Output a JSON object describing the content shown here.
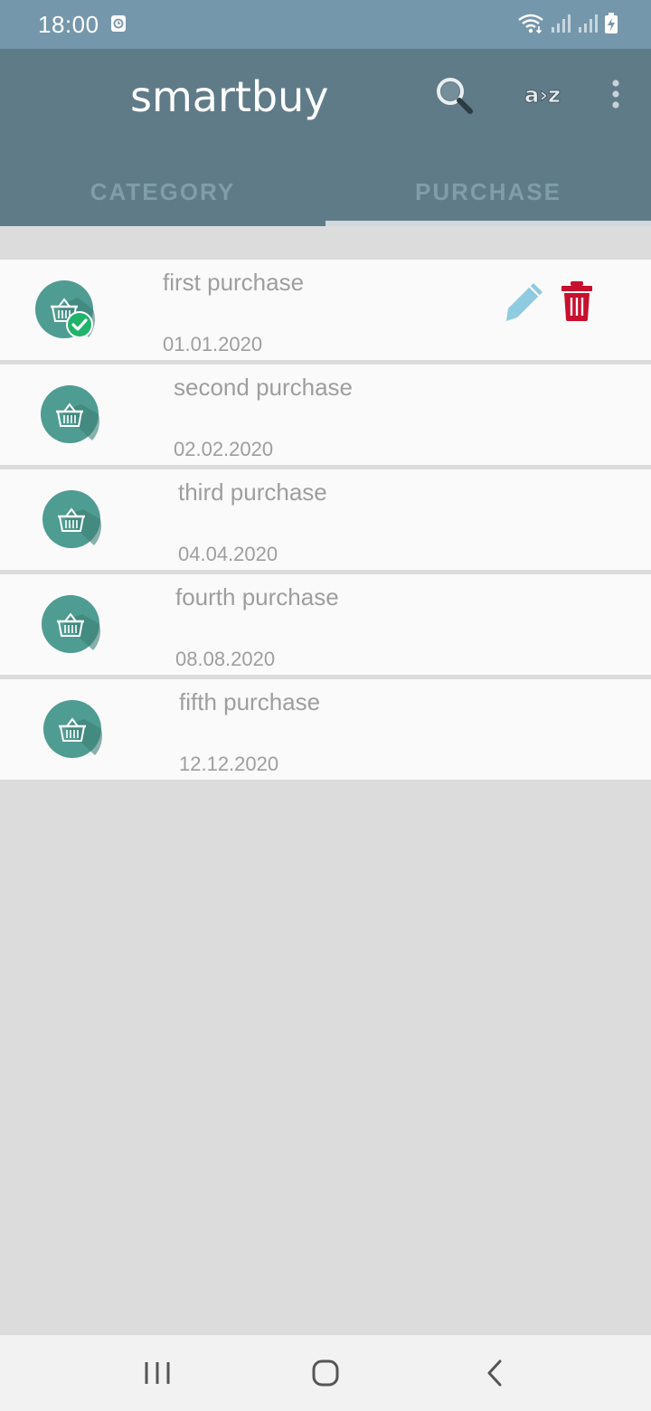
{
  "status_bar": {
    "time": "18:00",
    "icons": [
      "clock-icon",
      "wifi-icon",
      "signal-icon",
      "signal-icon",
      "battery-charging-icon"
    ]
  },
  "app_bar": {
    "title": "smartbuy",
    "actions": [
      "search-icon",
      "sort-az-icon",
      "more-vert-icon"
    ],
    "sort_label": "a›z"
  },
  "tabs": [
    {
      "label": "CATEGORY",
      "selected": false
    },
    {
      "label": "PURCHASE",
      "selected": true
    }
  ],
  "purchases": [
    {
      "name": "first purchase",
      "date": "01.01.2020",
      "completed": true
    },
    {
      "name": "second purchase",
      "date": "02.02.2020",
      "completed": false
    },
    {
      "name": "third purchase",
      "date": "04.04.2020",
      "completed": false
    },
    {
      "name": "fourth purchase",
      "date": "08.08.2020",
      "completed": false
    },
    {
      "name": "fifth purchase",
      "date": "12.12.2020",
      "completed": false
    }
  ],
  "nav_bar": [
    "recents-icon",
    "home-icon",
    "back-icon"
  ],
  "colors": {
    "status_bar": "#7597ab",
    "app_bar": "#5f7b88",
    "icon_circle": "#4f9c92",
    "check": "#21b36b",
    "edit": "#8fcbe0",
    "delete": "#c8102e"
  }
}
